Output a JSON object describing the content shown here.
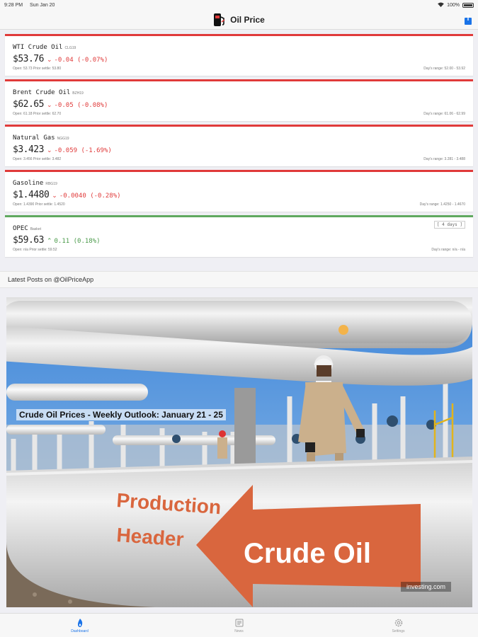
{
  "status": {
    "time": "9:28 PM",
    "date": "Sun Jan 20",
    "battery": "100%"
  },
  "nav": {
    "title": "Oil Price",
    "logo_icon": "oil-pump-icon",
    "action_icon": "share-icon",
    "accent": "#1a73e8"
  },
  "cards": [
    {
      "name": "WTI Crude Oil",
      "code": "CLG19",
      "price": "$53.76",
      "direction": "down",
      "change": "-0.04 (-0.07%)",
      "open": "Open: 53.73 Prior settle: 53.80",
      "range": "Day's range: 52.00 - 53.92"
    },
    {
      "name": "Brent Crude Oil",
      "code": "BZH19",
      "price": "$62.65",
      "direction": "down",
      "change": "-0.05 (-0.08%)",
      "open": "Open: 61.18 Prior settle: 62.70",
      "range": "Day's range: 61.06 - 62.99"
    },
    {
      "name": "Natural Gas",
      "code": "NGG19",
      "price": "$3.423",
      "direction": "down",
      "change": "-0.059 (-1.69%)",
      "open": "Open: 3.456 Prior settle: 3.482",
      "range": "Day's range: 3.281 - 3.488"
    },
    {
      "name": "Gasoline",
      "code": "RBG19",
      "price": "$1.4480",
      "direction": "down",
      "change": "-0.0040 (-0.28%)",
      "open": "Open: 1.4390 Prior settle: 1.4520",
      "range": "Day's range: 1.4250 - 1.4670"
    },
    {
      "name": "OPEC",
      "code": "Basket",
      "price": "$59.63",
      "direction": "up",
      "change": "0.11 (0.18%)",
      "open": "Open: n/a Prior settle: 59.52",
      "range": "Day's range: n/a - n/a",
      "tag": "[ 4 days ]"
    }
  ],
  "section": {
    "title": "Latest Posts on @OilPriceApp"
  },
  "post": {
    "title": "Crude Oil Prices - Weekly Outlook: January 21 - 25",
    "credit": "investing.com",
    "pipe_text_left_1": "Production",
    "pipe_text_left_2": "Header",
    "pipe_text_arrow": "Crude Oil"
  },
  "tabs": [
    {
      "label": "Dashboard",
      "icon": "flame-icon",
      "active": true
    },
    {
      "label": "News",
      "icon": "newspaper-icon",
      "active": false
    },
    {
      "label": "Settings",
      "icon": "gear-icon",
      "active": false
    }
  ],
  "colors": {
    "down": "#e03a3a",
    "up": "#4a9a4a",
    "tab_active": "#1a73e8"
  }
}
